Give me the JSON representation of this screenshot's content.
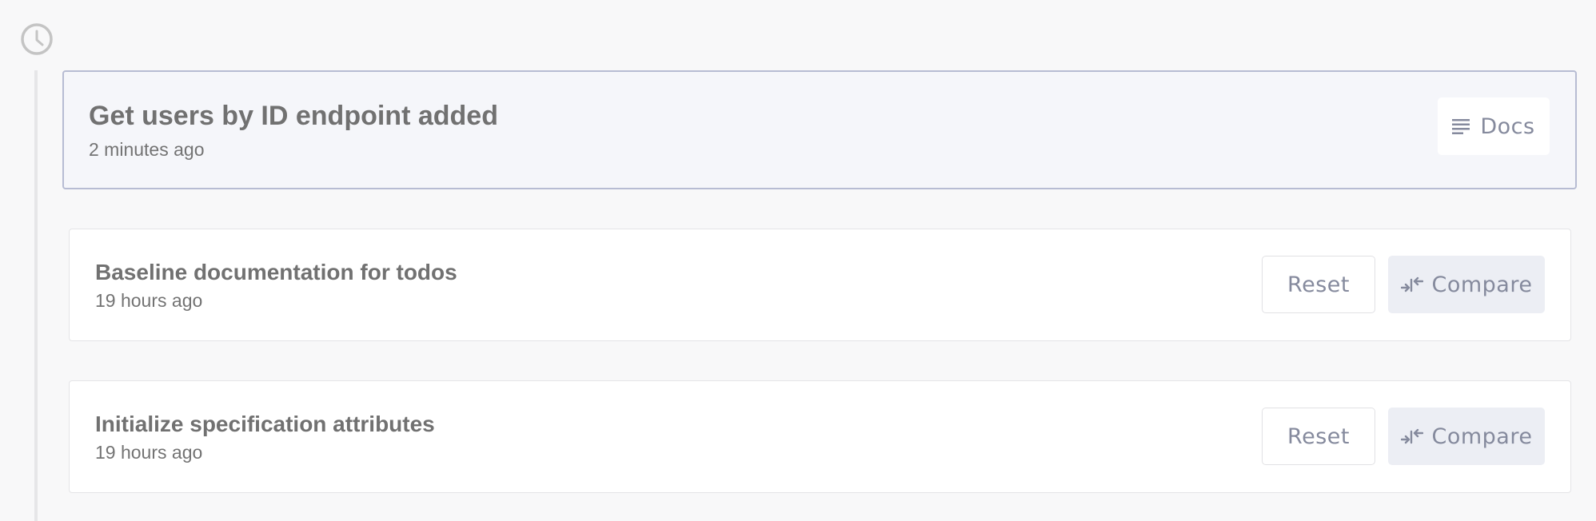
{
  "timeline": {
    "icon": "clock-icon"
  },
  "current_version": {
    "title": "Get users by ID endpoint added",
    "time": "2 minutes ago",
    "docs_label": "Docs",
    "docs_icon": "lines-icon"
  },
  "history": [
    {
      "title": "Baseline documentation for todos",
      "time": "19 hours ago",
      "reset_label": "Reset",
      "compare_label": "Compare",
      "compare_icon": "compare-arrows-icon"
    },
    {
      "title": "Initialize specification attributes",
      "time": "19 hours ago",
      "reset_label": "Reset",
      "compare_label": "Compare",
      "compare_icon": "compare-arrows-icon"
    }
  ],
  "colors": {
    "background": "#f8f8f9",
    "current_card_bg": "#f5f6fa",
    "current_card_border": "#b7bcd3",
    "button_text": "#858a9d",
    "compare_bg": "#eceef4"
  }
}
